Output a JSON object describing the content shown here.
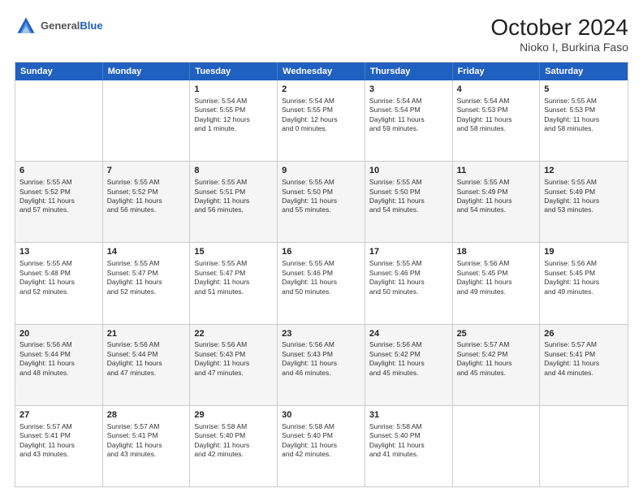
{
  "header": {
    "logo_general": "General",
    "logo_blue": "Blue",
    "title": "October 2024",
    "subtitle": "Nioko I, Burkina Faso"
  },
  "days": [
    "Sunday",
    "Monday",
    "Tuesday",
    "Wednesday",
    "Thursday",
    "Friday",
    "Saturday"
  ],
  "rows": [
    [
      {
        "day": "",
        "text": ""
      },
      {
        "day": "",
        "text": ""
      },
      {
        "day": "1",
        "text": "Sunrise: 5:54 AM\nSunset: 5:55 PM\nDaylight: 12 hours\nand 1 minute."
      },
      {
        "day": "2",
        "text": "Sunrise: 5:54 AM\nSunset: 5:55 PM\nDaylight: 12 hours\nand 0 minutes."
      },
      {
        "day": "3",
        "text": "Sunrise: 5:54 AM\nSunset: 5:54 PM\nDaylight: 11 hours\nand 59 minutes."
      },
      {
        "day": "4",
        "text": "Sunrise: 5:54 AM\nSunset: 5:53 PM\nDaylight: 11 hours\nand 58 minutes."
      },
      {
        "day": "5",
        "text": "Sunrise: 5:55 AM\nSunset: 5:53 PM\nDaylight: 11 hours\nand 58 minutes."
      }
    ],
    [
      {
        "day": "6",
        "text": "Sunrise: 5:55 AM\nSunset: 5:52 PM\nDaylight: 11 hours\nand 57 minutes."
      },
      {
        "day": "7",
        "text": "Sunrise: 5:55 AM\nSunset: 5:52 PM\nDaylight: 11 hours\nand 56 minutes."
      },
      {
        "day": "8",
        "text": "Sunrise: 5:55 AM\nSunset: 5:51 PM\nDaylight: 11 hours\nand 56 minutes."
      },
      {
        "day": "9",
        "text": "Sunrise: 5:55 AM\nSunset: 5:50 PM\nDaylight: 11 hours\nand 55 minutes."
      },
      {
        "day": "10",
        "text": "Sunrise: 5:55 AM\nSunset: 5:50 PM\nDaylight: 11 hours\nand 54 minutes."
      },
      {
        "day": "11",
        "text": "Sunrise: 5:55 AM\nSunset: 5:49 PM\nDaylight: 11 hours\nand 54 minutes."
      },
      {
        "day": "12",
        "text": "Sunrise: 5:55 AM\nSunset: 5:49 PM\nDaylight: 11 hours\nand 53 minutes."
      }
    ],
    [
      {
        "day": "13",
        "text": "Sunrise: 5:55 AM\nSunset: 5:48 PM\nDaylight: 11 hours\nand 52 minutes."
      },
      {
        "day": "14",
        "text": "Sunrise: 5:55 AM\nSunset: 5:47 PM\nDaylight: 11 hours\nand 52 minutes."
      },
      {
        "day": "15",
        "text": "Sunrise: 5:55 AM\nSunset: 5:47 PM\nDaylight: 11 hours\nand 51 minutes."
      },
      {
        "day": "16",
        "text": "Sunrise: 5:55 AM\nSunset: 5:46 PM\nDaylight: 11 hours\nand 50 minutes."
      },
      {
        "day": "17",
        "text": "Sunrise: 5:55 AM\nSunset: 5:46 PM\nDaylight: 11 hours\nand 50 minutes."
      },
      {
        "day": "18",
        "text": "Sunrise: 5:56 AM\nSunset: 5:45 PM\nDaylight: 11 hours\nand 49 minutes."
      },
      {
        "day": "19",
        "text": "Sunrise: 5:56 AM\nSunset: 5:45 PM\nDaylight: 11 hours\nand 49 minutes."
      }
    ],
    [
      {
        "day": "20",
        "text": "Sunrise: 5:56 AM\nSunset: 5:44 PM\nDaylight: 11 hours\nand 48 minutes."
      },
      {
        "day": "21",
        "text": "Sunrise: 5:56 AM\nSunset: 5:44 PM\nDaylight: 11 hours\nand 47 minutes."
      },
      {
        "day": "22",
        "text": "Sunrise: 5:56 AM\nSunset: 5:43 PM\nDaylight: 11 hours\nand 47 minutes."
      },
      {
        "day": "23",
        "text": "Sunrise: 5:56 AM\nSunset: 5:43 PM\nDaylight: 11 hours\nand 46 minutes."
      },
      {
        "day": "24",
        "text": "Sunrise: 5:56 AM\nSunset: 5:42 PM\nDaylight: 11 hours\nand 45 minutes."
      },
      {
        "day": "25",
        "text": "Sunrise: 5:57 AM\nSunset: 5:42 PM\nDaylight: 11 hours\nand 45 minutes."
      },
      {
        "day": "26",
        "text": "Sunrise: 5:57 AM\nSunset: 5:41 PM\nDaylight: 11 hours\nand 44 minutes."
      }
    ],
    [
      {
        "day": "27",
        "text": "Sunrise: 5:57 AM\nSunset: 5:41 PM\nDaylight: 11 hours\nand 43 minutes."
      },
      {
        "day": "28",
        "text": "Sunrise: 5:57 AM\nSunset: 5:41 PM\nDaylight: 11 hours\nand 43 minutes."
      },
      {
        "day": "29",
        "text": "Sunrise: 5:58 AM\nSunset: 5:40 PM\nDaylight: 11 hours\nand 42 minutes."
      },
      {
        "day": "30",
        "text": "Sunrise: 5:58 AM\nSunset: 5:40 PM\nDaylight: 11 hours\nand 42 minutes."
      },
      {
        "day": "31",
        "text": "Sunrise: 5:58 AM\nSunset: 5:40 PM\nDaylight: 11 hours\nand 41 minutes."
      },
      {
        "day": "",
        "text": ""
      },
      {
        "day": "",
        "text": ""
      }
    ]
  ]
}
